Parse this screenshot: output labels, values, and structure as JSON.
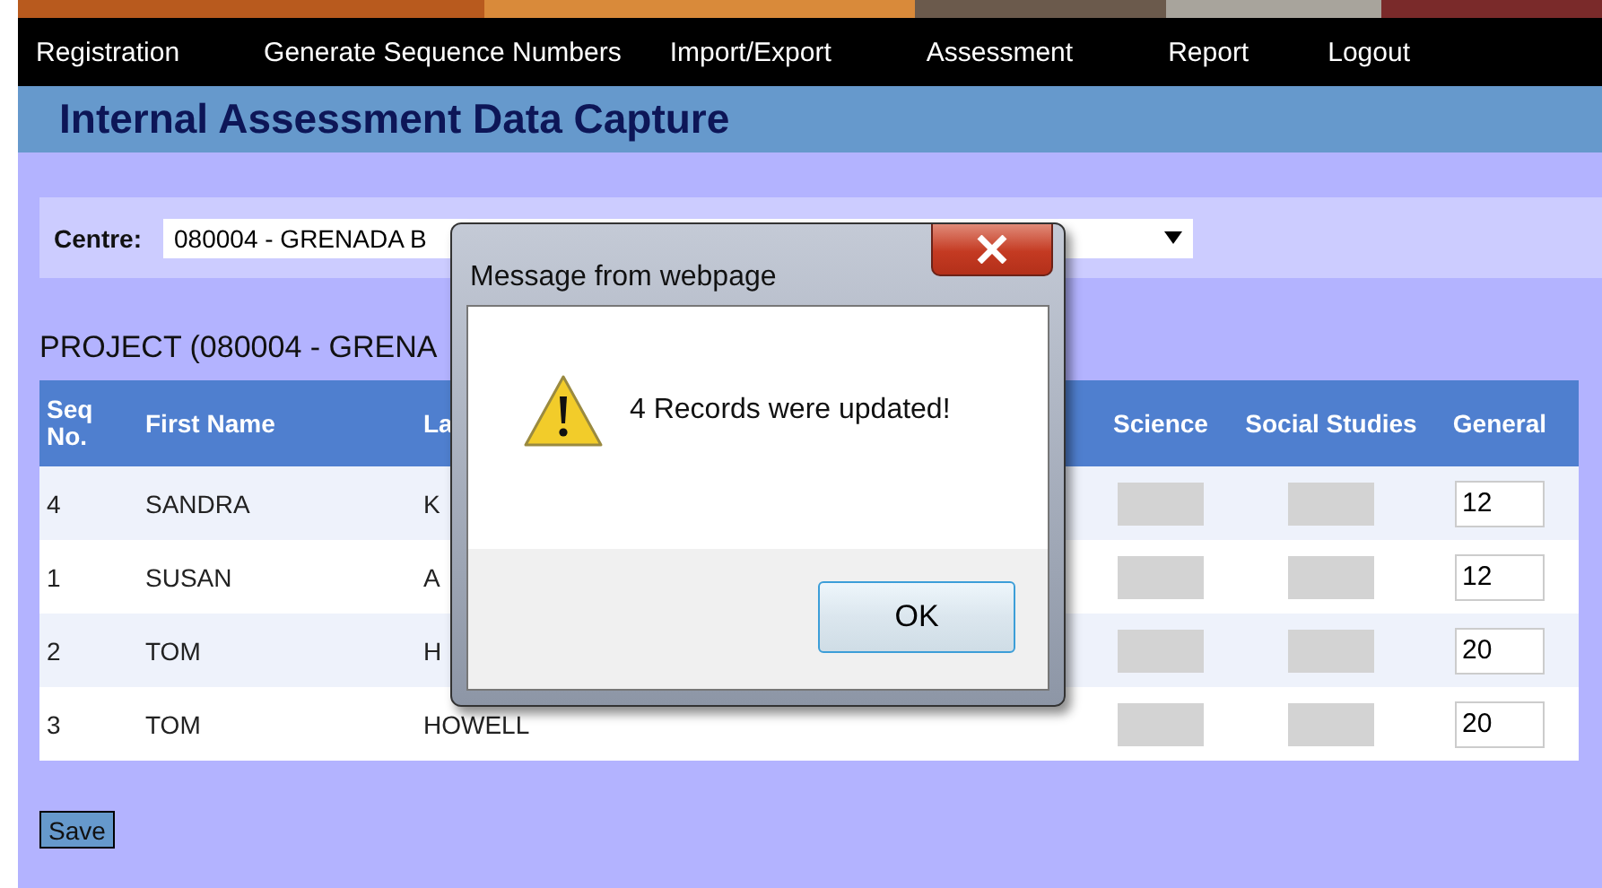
{
  "nav": {
    "items": [
      "Registration",
      "Generate Sequence Numbers",
      "Import/Export",
      "Assessment",
      "Report",
      "Logout"
    ]
  },
  "page_title": "Internal Assessment Data Capture",
  "centre": {
    "label": "Centre:",
    "value": "080004 - GRENADA B"
  },
  "section_heading": "PROJECT (080004 - GRENA",
  "table": {
    "columns": [
      "Seq No.",
      "First Name",
      "La",
      "Science",
      "Social Studies",
      "General"
    ],
    "rows": [
      {
        "seq": "4",
        "first_name": "SANDRA",
        "last_name": "K",
        "science_locked": true,
        "social_locked": true,
        "general": "12"
      },
      {
        "seq": "1",
        "first_name": "SUSAN",
        "last_name": "A",
        "science_locked": true,
        "social_locked": true,
        "general": "12"
      },
      {
        "seq": "2",
        "first_name": "TOM",
        "last_name": "H",
        "science_locked": true,
        "social_locked": true,
        "general": "20"
      },
      {
        "seq": "3",
        "first_name": "TOM",
        "last_name": "HOWELL",
        "science_locked": true,
        "social_locked": true,
        "general": "20"
      }
    ]
  },
  "save_button": "Save",
  "dialog": {
    "title": "Message from webpage",
    "message": "4 Records were updated!",
    "button": "OK"
  }
}
